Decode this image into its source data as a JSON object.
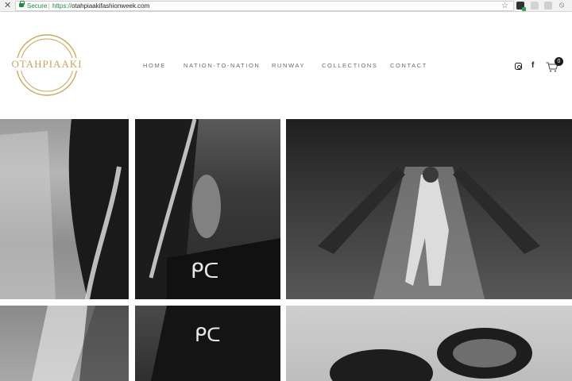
{
  "browser": {
    "close_glyph": "✕",
    "secure_label": "Secure",
    "url_protocol": "https://",
    "url_host": "otahpiaakifashionweek.com",
    "star_glyph": "☆",
    "ext_icons": [
      "shield-icon",
      "extension-a-icon",
      "extension-k-icon",
      "block-icon"
    ]
  },
  "site": {
    "logo_text": "OTAHPIAAKI",
    "brand_gold": "#c9a55a"
  },
  "nav": {
    "items": [
      "HOME",
      "NATION-TO-NATION",
      "RUNWAY",
      "COLLECTIONS",
      "CONTACT"
    ]
  },
  "header_icons": {
    "instagram": "instagram-icon",
    "facebook_glyph": "f",
    "cart_count": "0"
  },
  "gallery": {
    "tiles": [
      "fringe-garment-photo",
      "beaded-bag-hand-photo",
      "dancer-escalator-photo",
      "fringe-detail-photo",
      "syllabics-bag-photo",
      "beaded-earrings-photo"
    ]
  }
}
